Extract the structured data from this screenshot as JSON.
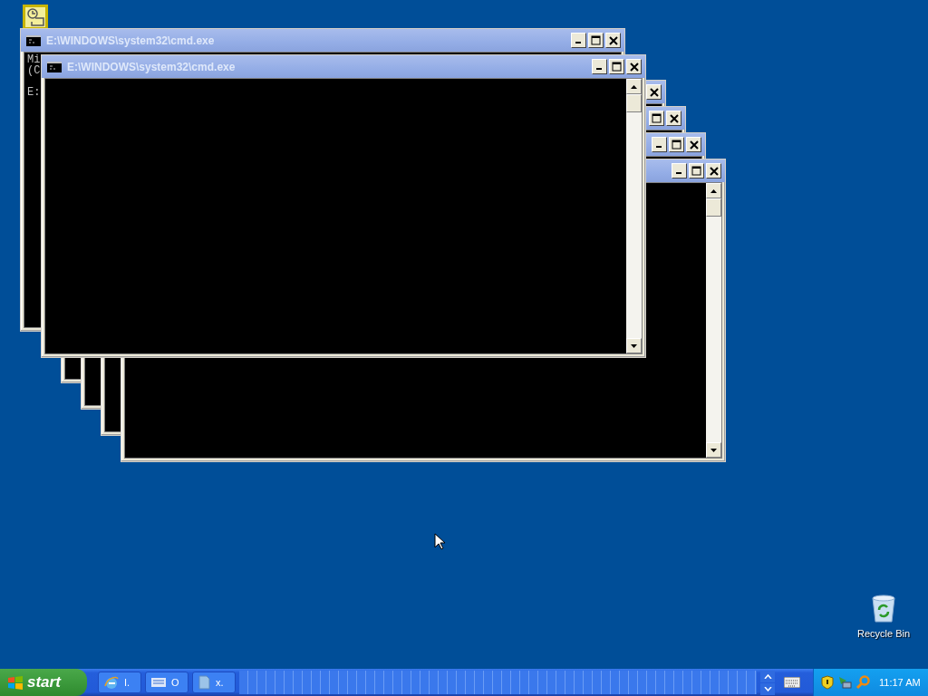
{
  "desktop_icons": [
    {
      "kind": "app"
    },
    {
      "kind": "recycle",
      "lines": [
        "Recycle Bin"
      ]
    }
  ],
  "windows": [
    {
      "title": "E:\\WINDOWS\\system32\\cmd.exe",
      "lines": [
        "Mi",
        "(C",
        "E:"
      ],
      "minimize": true,
      "maximize": true,
      "close": true
    },
    {
      "title": "E:\\WINDOWS\\system32\\cmd.exe",
      "minimize": true,
      "maximize": true,
      "close": true,
      "scrollbar": true
    },
    {
      "close": true
    },
    {
      "maximize": true,
      "close": true
    },
    {
      "minimize": true,
      "maximize": true,
      "close": true
    },
    {
      "minimize": true,
      "maximize": true,
      "close": true,
      "scrollbar": true
    }
  ],
  "taskbar": {
    "start": "start",
    "tasks": [
      {
        "kind": "browser",
        "label": "I."
      },
      {
        "kind": "keyboard",
        "label": "O"
      },
      {
        "kind": "document",
        "label": "x."
      }
    ],
    "clock": "11:17 AM"
  }
}
